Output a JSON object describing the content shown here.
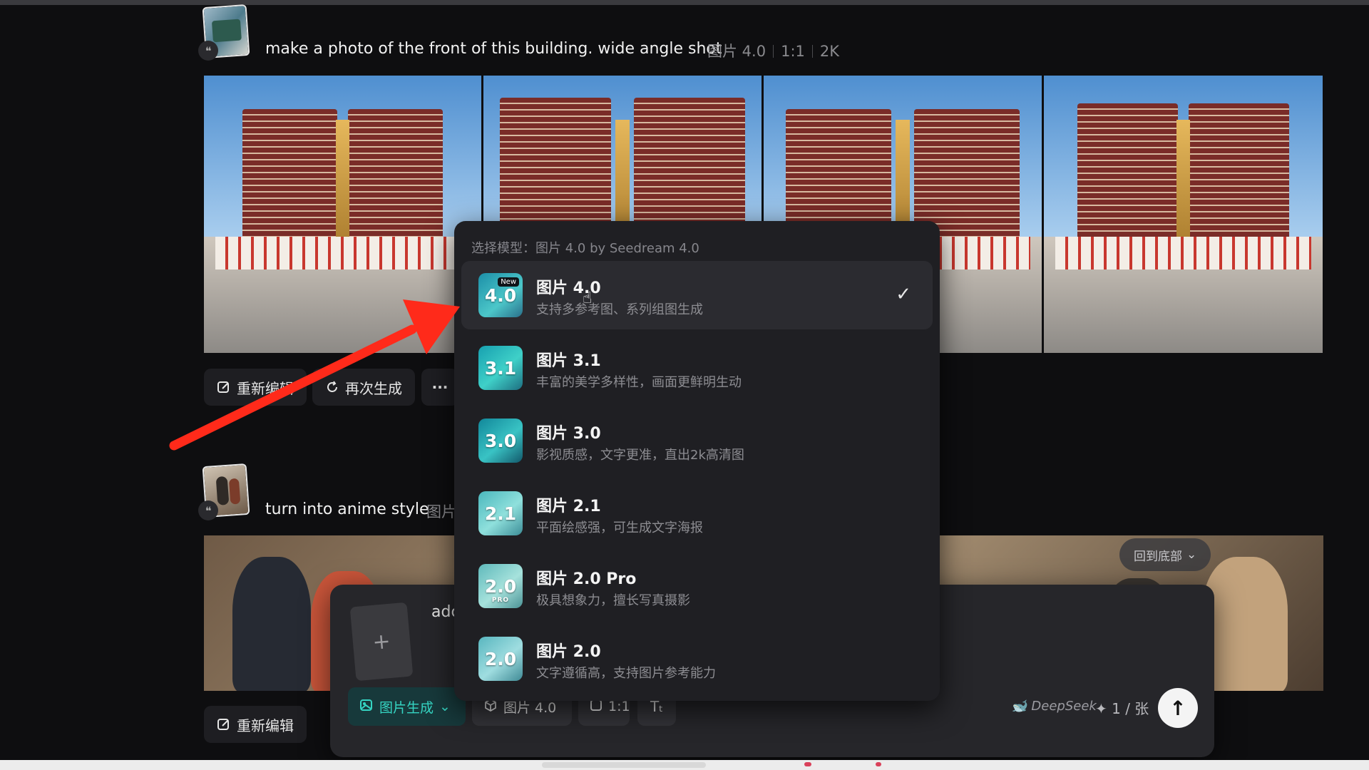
{
  "feed": {
    "post1": {
      "prompt": "make a photo of the front of this building. wide angle shot",
      "model": "图片 4.0",
      "ratio": "1:1",
      "resolution": "2K",
      "actions": {
        "reedit": "重新编辑",
        "regenerate": "再次生成",
        "more": "···"
      }
    },
    "post2": {
      "prompt": "turn into anime style",
      "meta_partial": "图片",
      "actions": {
        "reedit": "重新编辑"
      }
    },
    "quote_glyph": "❝"
  },
  "scroll_to_bottom": "回到底部",
  "composer": {
    "text_partial": "adc",
    "upload_plus": "+",
    "mode_label": "图片生成",
    "model_label": "图片 4.0",
    "ratio_label": "1:1",
    "deepseek_label": "DeepSeek",
    "credits_label": "1 / 张"
  },
  "model_dropdown": {
    "header": "选择模型：图片 4.0 by Seedream 4.0",
    "models": [
      {
        "icon_text": "4.0",
        "badge": "New",
        "name": "图片 4.0",
        "desc": "支持多参考图、系列组图生成",
        "selected": true
      },
      {
        "icon_text": "3.1",
        "name": "图片 3.1",
        "desc": "丰富的美学多样性，画面更鲜明生动",
        "selected": false
      },
      {
        "icon_text": "3.0",
        "name": "图片 3.0",
        "desc": "影视质感，文字更准，直出2k高清图",
        "selected": false
      },
      {
        "icon_text": "2.1",
        "name": "图片 2.1",
        "desc": "平面绘感强，可生成文字海报",
        "selected": false
      },
      {
        "icon_text": "2.0",
        "icon_sub": "PRO",
        "name": "图片 2.0 Pro",
        "desc": "极具想象力，擅长写真摄影",
        "selected": false
      },
      {
        "icon_text": "2.0",
        "name": "图片 2.0",
        "desc": "文字遵循高，支持图片参考能力",
        "selected": false
      }
    ]
  },
  "colors": {
    "accent_teal": "#35d4c2",
    "annotation_arrow": "#ff2a1a",
    "background": "#0e0e10",
    "dropdown_bg": "#1f1f23"
  },
  "icons": {
    "check": "check-icon",
    "send": "arrow-up-icon",
    "cursor": "pointer-cursor-icon"
  }
}
